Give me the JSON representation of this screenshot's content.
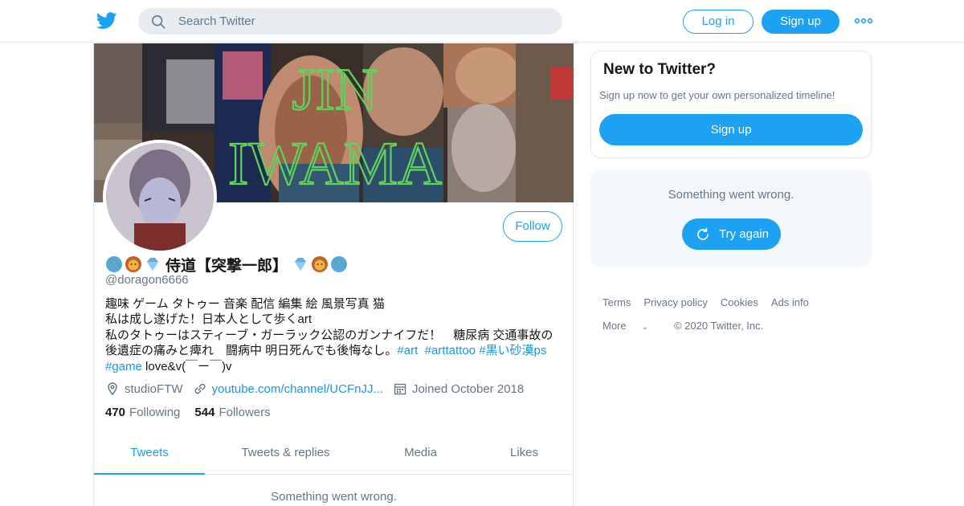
{
  "header": {
    "search_placeholder": "Search Twitter",
    "login_label": "Log in",
    "signup_label": "Sign up"
  },
  "profile": {
    "banner_text_line1": "JIN",
    "banner_text_line2": "IWAMA",
    "follow_label": "Follow",
    "name": "侍道【突撃一郎】",
    "handle": "@doragon6666",
    "bio_line1": "趣味 ゲーム タトゥー 音楽 配信 編集 絵 風景写真 猫",
    "bio_line2": "私は成し遂げた！日本人として歩くart",
    "bio_line3": "私のタトゥーはスティーブ・ガーラック公認のガンナイフだ！　糖尿病 交通事故の",
    "bio_line4_text": "後遺症の痛みと痺れ　闘病中 明日死んでも後悔なし。",
    "bio_tag_art": "#art",
    "bio_tag_arttattoo": "#arttattoo",
    "bio_tag_kuroi": "#黒い砂漠ps",
    "bio_tag_game": "#game",
    "bio_line5_text": " love&v(￣ー￣)v",
    "location": "studioFTW",
    "website": "youtube.com/channel/UCFnJJ...",
    "joined": "Joined October 2018",
    "following_count": "470",
    "following_label": "Following",
    "followers_count": "544",
    "followers_label": "Followers"
  },
  "tabs": [
    {
      "label": "Tweets",
      "active": true
    },
    {
      "label": "Tweets & replies",
      "active": false
    },
    {
      "label": "Media",
      "active": false
    },
    {
      "label": "Likes",
      "active": false
    }
  ],
  "feed": {
    "error_text": "Something went wrong."
  },
  "sidebar": {
    "new_title": "New to Twitter?",
    "new_subtitle": "Sign up now to get your own personalized timeline!",
    "new_signup_label": "Sign up",
    "error_text": "Something went wrong.",
    "retry_label": "Try again"
  },
  "footer": {
    "terms": "Terms",
    "privacy": "Privacy policy",
    "cookies": "Cookies",
    "ads": "Ads info",
    "more": "More",
    "copyright": "© 2020 Twitter, Inc."
  },
  "colors": {
    "accent": "#1da1f2",
    "link": "#1b95e0",
    "muted": "#657786",
    "text": "#14171a",
    "banner_title": "#5fd35a"
  },
  "icons": [
    "twitter-bird-icon",
    "search-icon",
    "more-dots-icon",
    "globe-emoji",
    "lion-emoji",
    "gem-emoji",
    "location-icon",
    "link-icon",
    "calendar-icon",
    "refresh-icon",
    "chevron-down-icon"
  ]
}
